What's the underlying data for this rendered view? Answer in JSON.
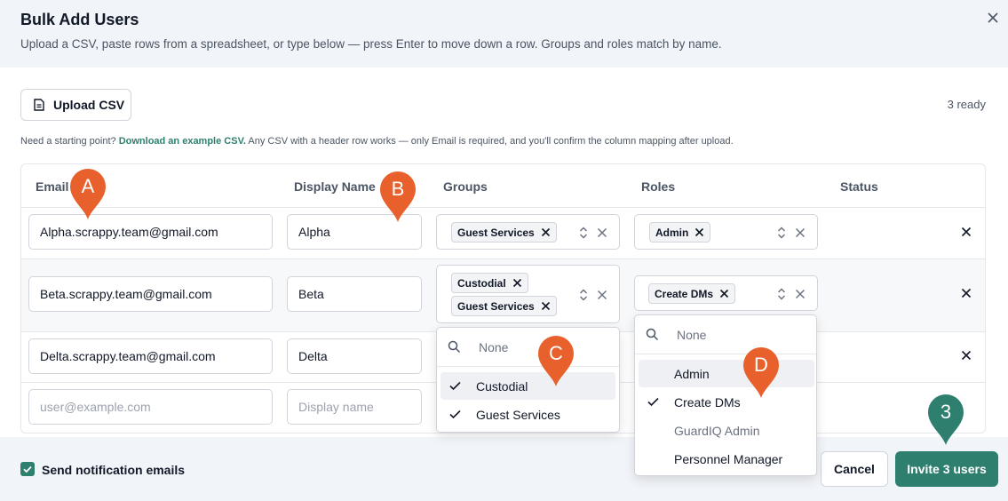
{
  "dialog": {
    "title": "Bulk Add Users",
    "subtitle": "Upload a CSV, paste rows from a spreadsheet, or type below — press Enter to move down a row. Groups and roles match by name."
  },
  "toolbar": {
    "upload_label": "Upload CSV",
    "ready_count": "3 ready"
  },
  "hint": {
    "prefix": "Need a starting point?",
    "link": "Download an example CSV.",
    "suffix": "Any CSV with a header row works — only Email is required, and you'll confirm the column mapping after upload."
  },
  "table": {
    "columns": [
      "Email",
      "Display Name",
      "Groups",
      "Roles",
      "Status"
    ],
    "rows": [
      {
        "email": "Alpha.scrappy.team@gmail.com",
        "display_name": "Alpha",
        "groups": [
          "Guest Services"
        ],
        "roles": [
          "Admin"
        ]
      },
      {
        "email": "Beta.scrappy.team@gmail.com",
        "display_name": "Beta",
        "groups": [
          "Custodial",
          "Guest Services"
        ],
        "roles": [
          "Create DMs"
        ]
      },
      {
        "email": "Delta.scrappy.team@gmail.com",
        "display_name": "Delta",
        "groups": [],
        "roles": []
      }
    ],
    "new_row": {
      "email_placeholder": "user@example.com",
      "display_name_placeholder": "Display name"
    }
  },
  "groups_dropdown": {
    "search_placeholder": "None",
    "options": [
      {
        "label": "Custodial",
        "checked": true
      },
      {
        "label": "Guest Services",
        "checked": true
      }
    ]
  },
  "roles_dropdown": {
    "search_placeholder": "None",
    "options": [
      {
        "label": "Admin",
        "checked": false,
        "highlighted": true
      },
      {
        "label": "Create DMs",
        "checked": true
      },
      {
        "label": "GuardIQ Admin",
        "checked": false,
        "disabled": true
      },
      {
        "label": "Personnel Manager",
        "checked": false
      }
    ]
  },
  "footer": {
    "notify_label": "Send notification emails",
    "notify_checked": true,
    "cancel_label": "Cancel",
    "invite_label": "Invite 3 users"
  },
  "markers": [
    {
      "label": "A",
      "color": "#e8612c"
    },
    {
      "label": "B",
      "color": "#e8612c"
    },
    {
      "label": "C",
      "color": "#e8612c"
    },
    {
      "label": "D",
      "color": "#e8612c"
    },
    {
      "label": "3",
      "color": "#2f7f6f"
    }
  ],
  "colors": {
    "accent": "#2f7f6f",
    "marker_orange": "#e8612c",
    "header_bg": "#f1f4f8"
  }
}
